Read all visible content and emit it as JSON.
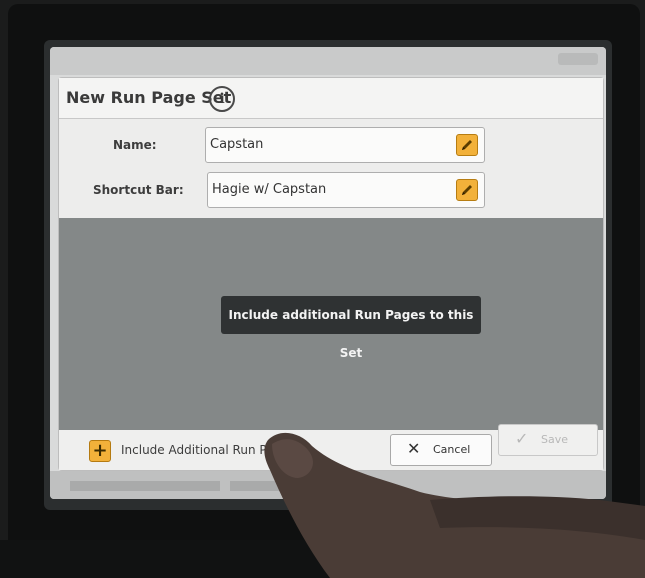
{
  "dialog": {
    "title": "New Run Page Set",
    "info_icon": "info-icon"
  },
  "form": {
    "name_label": "Name:",
    "name_value": "Capstan",
    "shortcut_label": "Shortcut Bar:",
    "shortcut_value": "Hagie w/ Capstan",
    "edit_icon": "pencil-icon"
  },
  "message": {
    "text": "Include additional Run Pages to this Set"
  },
  "footer": {
    "include_icon": "plus-icon",
    "include_label": "Include Additional Run P",
    "cancel_label": "Cancel",
    "cancel_icon": "x-icon",
    "save_label": "Save",
    "save_icon": "check-icon"
  },
  "colors": {
    "accent": "#f2b13a",
    "content_bg": "#848888",
    "toast_bg": "#2f3233"
  }
}
